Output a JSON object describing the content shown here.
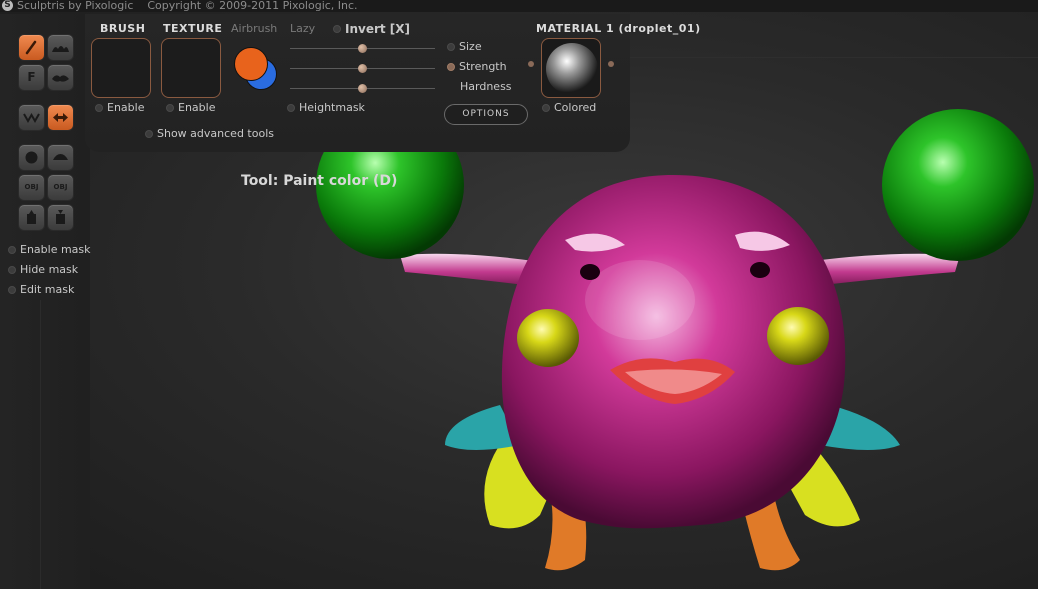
{
  "titlebar": {
    "app": "Sculptris by Pixologic",
    "copyright": "Copyright © 2009-2011 Pixologic, Inc."
  },
  "toolbar": {
    "brush_label": "BRUSH",
    "texture_label": "TEXTURE",
    "airbrush_label": "Airbrush",
    "lazy_label": "Lazy",
    "invert_label": "Invert [X]",
    "brush_enable": "Enable",
    "texture_enable": "Enable",
    "heightmask_label": "Heightmask",
    "advanced_label": "Show advanced tools",
    "size_label": "Size",
    "strength_label": "Strength",
    "hardness_label": "Hardness",
    "options_label": "OPTIONS",
    "material_title": "MATERIAL 1 (droplet_01)",
    "colored_label": "Colored",
    "primary_color": "#e8631c",
    "secondary_color": "#2a6ce0",
    "sliders": {
      "size": 0.5,
      "strength": 0.5,
      "hardness": 0.5
    }
  },
  "left_tools": {
    "mask_options": [
      "Enable mask",
      "Hide mask",
      "Edit mask"
    ],
    "buttons": [
      {
        "icon": "paint-brush-icon",
        "label": "",
        "active": true
      },
      {
        "icon": "paint-bumps-icon",
        "label": "",
        "active": false
      },
      {
        "icon": "fill-icon",
        "label": "F",
        "active": false
      },
      {
        "icon": "mask-lips-icon",
        "label": "",
        "active": false
      },
      {
        "icon": "symmetry-icon",
        "label": "",
        "active": false
      },
      {
        "icon": "arrows-horizontal-icon",
        "label": "",
        "active": true
      },
      {
        "icon": "sphere-icon",
        "label": "",
        "active": false
      },
      {
        "icon": "flat-plane-icon",
        "label": "",
        "active": false
      },
      {
        "icon": "import-obj-icon",
        "label": "OBJ",
        "active": false
      },
      {
        "icon": "export-obj-icon",
        "label": "OBJ",
        "active": false
      },
      {
        "icon": "open-file-icon",
        "label": "",
        "active": false
      },
      {
        "icon": "save-file-icon",
        "label": "",
        "active": false
      }
    ]
  },
  "viewport": {
    "tool_status": "Tool: Paint color (D)"
  }
}
